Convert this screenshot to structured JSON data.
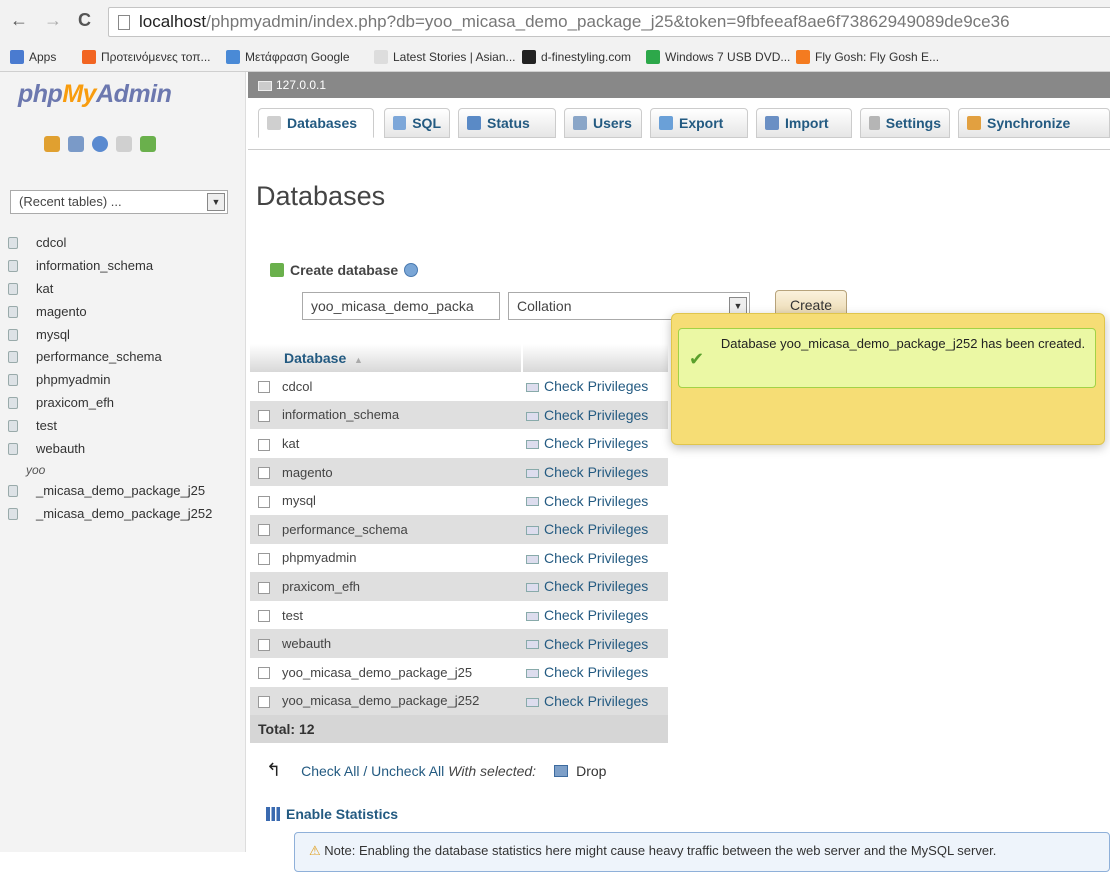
{
  "browser": {
    "url_host": "localhost",
    "url_rest": "/phpmyadmin/index.php?db=yoo_micasa_demo_package_j25&token=9fbfeeaf8ae6f73862949089de9ce36",
    "bookmarks": [
      {
        "label": "Apps",
        "color": "#4a7bd0"
      },
      {
        "label": "Προτεινόμενες τοπ...",
        "color": "#f26522"
      },
      {
        "label": "Μετάφραση Google",
        "color": "#4a8ad6"
      },
      {
        "label": "Latest Stories | Asian...",
        "color": "#dddddd"
      },
      {
        "label": "d-finestyling.com",
        "color": "#222222"
      },
      {
        "label": "Windows 7 USB DVD...",
        "color": "#2da84a"
      },
      {
        "label": "Fly Gosh: Fly Gosh E...",
        "color": "#f47b20"
      }
    ]
  },
  "logo": {
    "php": "php",
    "my": "My",
    "admin": "Admin"
  },
  "sidebar": {
    "recent_tables": "(Recent tables) ...",
    "databases": [
      "cdcol",
      "information_schema",
      "kat",
      "magento",
      "mysql",
      "performance_schema",
      "phpmyadmin",
      "praxicom_efh",
      "test",
      "webauth"
    ],
    "group_label": "yoo",
    "group_items": [
      "_micasa_demo_package_j25",
      "_micasa_demo_package_j252"
    ]
  },
  "serverbar": {
    "label": "127.0.0.1"
  },
  "tabs": [
    {
      "label": "Databases",
      "icon": "database-icon",
      "active": true
    },
    {
      "label": "SQL",
      "icon": "sql-icon",
      "active": false
    },
    {
      "label": "Status",
      "icon": "status-icon",
      "active": false
    },
    {
      "label": "Users",
      "icon": "users-icon",
      "active": false
    },
    {
      "label": "Export",
      "icon": "export-icon",
      "active": false
    },
    {
      "label": "Import",
      "icon": "import-icon",
      "active": false
    },
    {
      "label": "Settings",
      "icon": "settings-icon",
      "active": false
    },
    {
      "label": "Synchronize",
      "icon": "synchronize-icon",
      "active": false
    }
  ],
  "main": {
    "title": "Databases",
    "create_db_label": "Create database",
    "dbname_value": "yoo_micasa_demo_packa",
    "collation_value": "Collation",
    "create_button": "Create",
    "table": {
      "header": "Database",
      "sort_indicator": "▲",
      "rows": [
        {
          "name": "cdcol",
          "action": "Check Privileges"
        },
        {
          "name": "information_schema",
          "action": "Check Privileges"
        },
        {
          "name": "kat",
          "action": "Check Privileges"
        },
        {
          "name": "magento",
          "action": "Check Privileges"
        },
        {
          "name": "mysql",
          "action": "Check Privileges"
        },
        {
          "name": "performance_schema",
          "action": "Check Privileges"
        },
        {
          "name": "phpmyadmin",
          "action": "Check Privileges"
        },
        {
          "name": "praxicom_efh",
          "action": "Check Privileges"
        },
        {
          "name": "test",
          "action": "Check Privileges"
        },
        {
          "name": "webauth",
          "action": "Check Privileges"
        },
        {
          "name": "yoo_micasa_demo_package_j25",
          "action": "Check Privileges"
        },
        {
          "name": "yoo_micasa_demo_package_j252",
          "action": "Check Privileges"
        }
      ],
      "total": "Total: 12"
    },
    "check_all": "Check All / Uncheck All",
    "with_selected": "With selected:",
    "drop": "Drop",
    "enable_stats": "Enable Statistics",
    "note": "Note: Enabling the database statistics here might cause heavy traffic between the web server and the MySQL server."
  },
  "notification": {
    "message": "Database yoo_micasa_demo_package_j252 has been created."
  }
}
